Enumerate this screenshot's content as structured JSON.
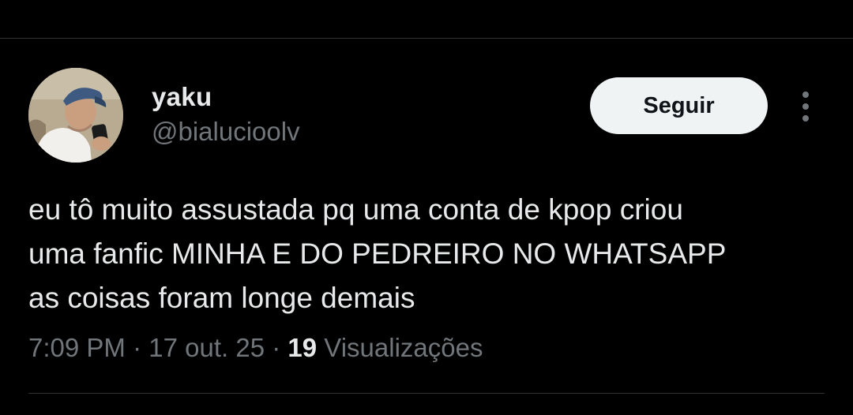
{
  "author": {
    "display_name": "yaku",
    "handle": "@bialucioolv",
    "avatar_icon": "profile-photo"
  },
  "actions": {
    "follow_label": "Seguir",
    "more_icon": "more-vertical-icon"
  },
  "tweet": {
    "lines": [
      "eu tô muito assustada pq uma conta de kpop criou",
      "uma fanfic MINHA E DO PEDREIRO NO WHATSAPP",
      "as coisas foram longe demais"
    ]
  },
  "meta": {
    "time": "7:09 PM",
    "separator": "·",
    "date": "17 out. 25",
    "views_count": "19",
    "views_label": "Visualizações"
  },
  "colors": {
    "background": "#000000",
    "text": "#e7e9ea",
    "secondary": "#71767b",
    "divider": "#2f3336",
    "button_bg": "#eff3f4"
  }
}
